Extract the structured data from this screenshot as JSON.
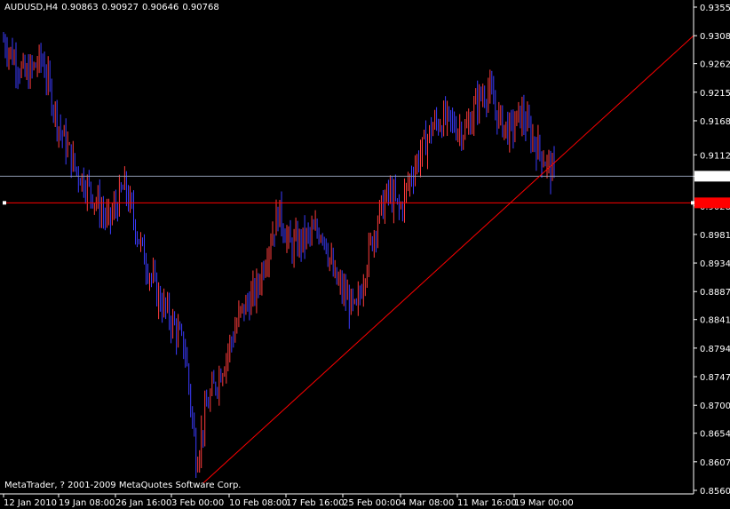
{
  "header": {
    "symbol": "AUDUSD,H4",
    "open": "0.90863",
    "high": "0.90927",
    "low": "0.90646",
    "close": "0.90768"
  },
  "copyright": "MetaTrader, ? 2001-2009 MetaQuotes Software Corp.",
  "colors": {
    "background": "#000000",
    "bar_up": "#ff3b3b",
    "bar_down": "#3b3bff",
    "trendline": "#ff0000",
    "hline": "#ff0000",
    "bid_line": "#8f9ab0",
    "axis": "#ffffff"
  },
  "chart_data": {
    "type": "ohlc-bars",
    "title": "AUDUSD,H4",
    "price_axis_labels": [
      "0.93550",
      "0.93080",
      "0.92620",
      "0.92150",
      "0.91680",
      "0.91120",
      "0.90768",
      "0.90280",
      "0.89810",
      "0.89340",
      "0.88870",
      "0.88410",
      "0.87940",
      "0.87470",
      "0.87000",
      "0.86540",
      "0.86070",
      "0.85600"
    ],
    "ylim": [
      0.8556,
      0.9365
    ],
    "time_axis_labels": [
      "12 Jan 2010",
      "19 Jan 08:00",
      "26 Jan 16:00",
      "3 Feb 00:00",
      "10 Feb 08:00",
      "17 Feb 16:00",
      "25 Feb 00:00",
      "4 Mar 08:00",
      "11 Mar 16:00",
      "19 Mar 00:00"
    ],
    "current_price": 0.90768,
    "horizontal_line_price": 0.9033,
    "trendline": {
      "start": {
        "time": "3 Feb 00:00",
        "price": 0.8572
      },
      "end": {
        "time": "after 19 Mar 00:00",
        "price": 0.9308
      }
    },
    "close_path": [
      [
        0.0,
        0.93
      ],
      [
        0.04,
        0.924
      ],
      [
        0.07,
        0.927
      ],
      [
        0.1,
        0.916
      ],
      [
        0.13,
        0.909
      ],
      [
        0.16,
        0.905
      ],
      [
        0.19,
        0.9
      ],
      [
        0.22,
        0.906
      ],
      [
        0.25,
        0.896
      ],
      [
        0.28,
        0.888
      ],
      [
        0.31,
        0.883
      ],
      [
        0.33,
        0.879
      ],
      [
        0.35,
        0.861
      ],
      [
        0.37,
        0.87
      ],
      [
        0.4,
        0.877
      ],
      [
        0.43,
        0.885
      ],
      [
        0.46,
        0.889
      ],
      [
        0.48,
        0.896
      ],
      [
        0.5,
        0.902
      ],
      [
        0.52,
        0.896
      ],
      [
        0.54,
        0.897
      ],
      [
        0.56,
        0.898
      ],
      [
        0.58,
        0.899
      ],
      [
        0.6,
        0.891
      ],
      [
        0.62,
        0.888
      ],
      [
        0.64,
        0.885
      ],
      [
        0.66,
        0.894
      ],
      [
        0.68,
        0.901
      ],
      [
        0.7,
        0.905
      ],
      [
        0.72,
        0.902
      ],
      [
        0.74,
        0.908
      ],
      [
        0.76,
        0.912
      ],
      [
        0.78,
        0.916
      ],
      [
        0.8,
        0.917
      ],
      [
        0.82,
        0.916
      ],
      [
        0.84,
        0.915
      ],
      [
        0.86,
        0.92
      ],
      [
        0.88,
        0.922
      ],
      [
        0.9,
        0.917
      ],
      [
        0.92,
        0.915
      ],
      [
        0.94,
        0.918
      ],
      [
        0.96,
        0.914
      ],
      [
        1.0,
        0.9077
      ]
    ]
  }
}
